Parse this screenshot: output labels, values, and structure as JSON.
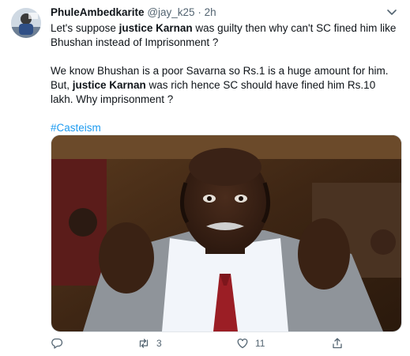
{
  "tweet": {
    "display_name": "PhuleAmbedkarite",
    "handle": "@jay_k25",
    "separator": "·",
    "time": "2h",
    "para1": [
      {
        "text": "Let's suppose ",
        "bold": false
      },
      {
        "text": "justice Karnan",
        "bold": true
      },
      {
        "text": " was guilty then why can't SC fined him like Bhushan instead of Imprisonment ?",
        "bold": false
      }
    ],
    "para2": [
      {
        "text": "We know Bhushan is a poor Savarna so Rs.1 is a huge amount for him. But, ",
        "bold": false
      },
      {
        "text": "justice Karnan",
        "bold": true
      },
      {
        "text": " was rich hence SC should have fined him Rs.10 lakh. Why imprisonment ?",
        "bold": false
      }
    ],
    "hashtag": "#Casteism"
  },
  "actions": {
    "reply_count": "",
    "retweet_count": "3",
    "like_count": "11"
  },
  "icons": [
    "avatar",
    "chevron-down-icon",
    "reply-icon",
    "retweet-icon",
    "like-icon",
    "share-icon"
  ],
  "colors": {
    "link": "#1d9bf0",
    "muted": "#536471",
    "text": "#0f1419"
  }
}
